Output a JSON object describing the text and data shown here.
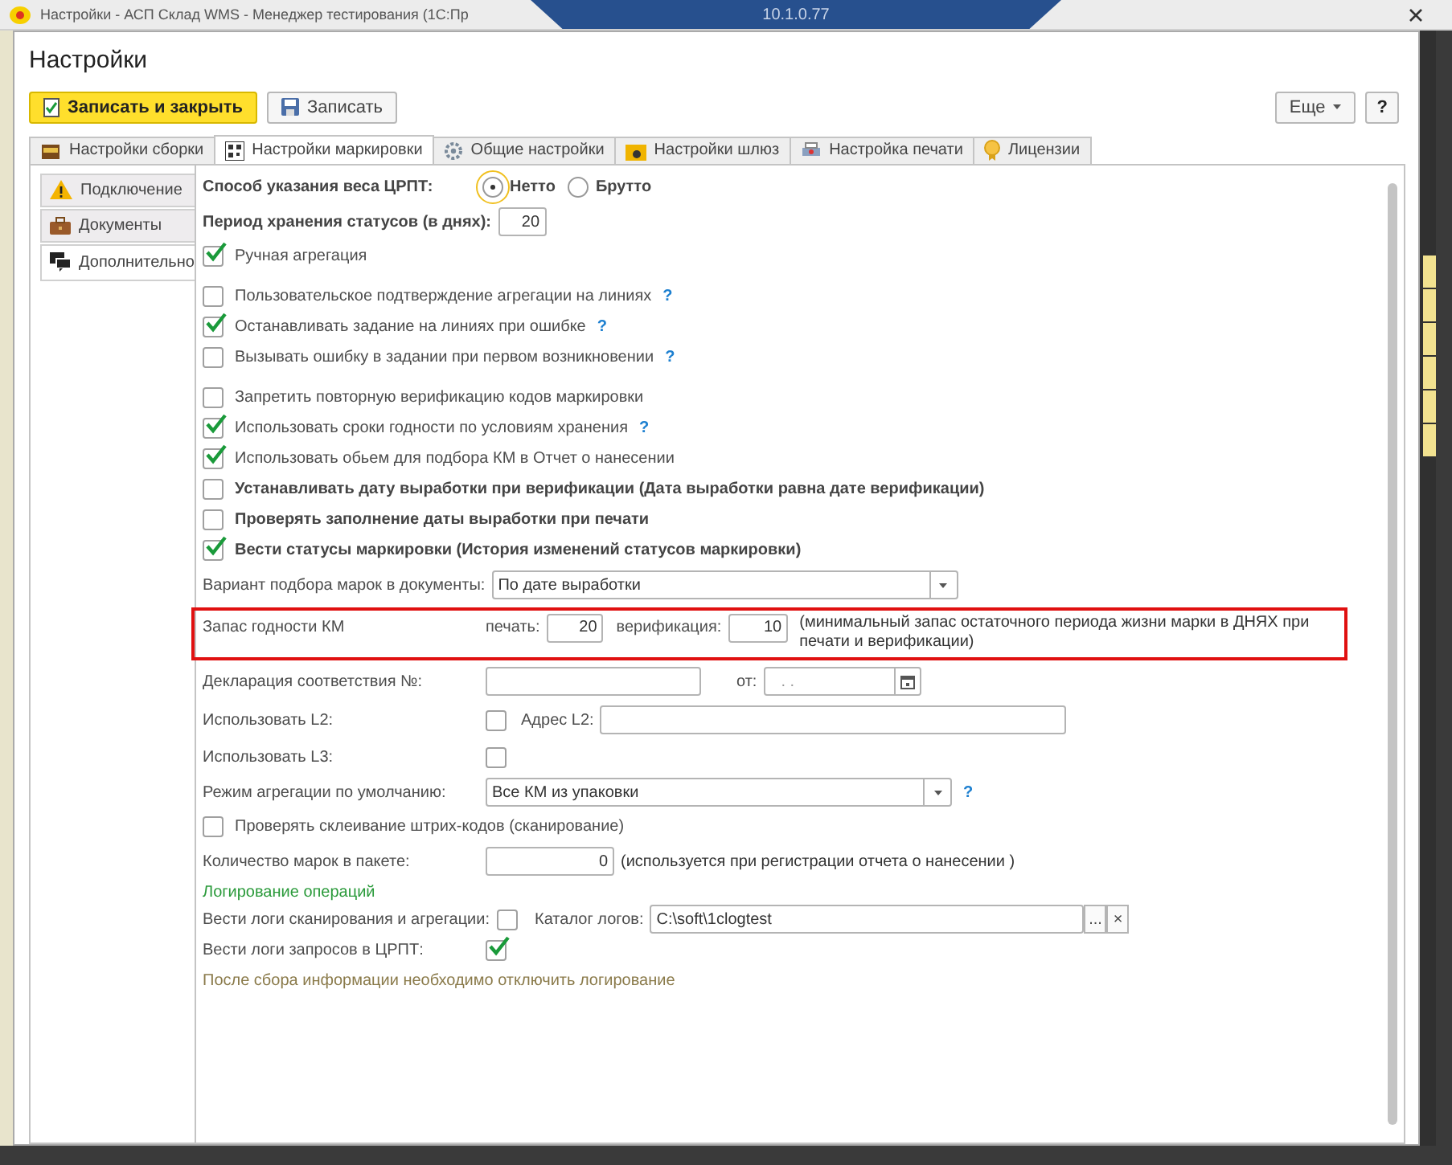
{
  "window": {
    "title": "Настройки - АСП Склад WMS - Менеджер тестирования (1С:Пр",
    "remote_bar": "10.1.0.77"
  },
  "form_title": "Настройки",
  "toolbar": {
    "buttons": [
      {
        "label": "Записать и закрыть",
        "kind": "primary"
      },
      {
        "label": "Записать",
        "kind": "save"
      }
    ],
    "more": "Еще",
    "help": "?"
  },
  "tabs": [
    {
      "label": "Настройки сборки",
      "selected": false
    },
    {
      "label": "Настройки маркировки",
      "selected": true
    },
    {
      "label": "Общие настройки",
      "selected": false
    },
    {
      "label": "Настройки шлюз",
      "selected": false
    },
    {
      "label": "Настройка печати",
      "selected": false
    },
    {
      "label": "Лицензии",
      "selected": false
    }
  ],
  "side_tabs": [
    {
      "label": "Подключение",
      "selected": false
    },
    {
      "label": "Документы",
      "selected": false
    },
    {
      "label": "Дополнительно",
      "selected": true
    }
  ],
  "weight_method": {
    "label": "Способ указания веса ЦРПТ:",
    "options": [
      {
        "label": "Нетто",
        "selected": true
      },
      {
        "label": "Брутто",
        "selected": false
      }
    ]
  },
  "storage_period": {
    "label": "Период хранения статусов (в днях):",
    "value": "20"
  },
  "checkbox_groups": [
    [
      {
        "label": "Ручная агрегация",
        "checked": true,
        "bold": false
      }
    ],
    [
      {
        "label": "Пользовательское подтверждение агрегации на линиях",
        "checked": false,
        "bold": false,
        "help": "?"
      },
      {
        "label": "Останавливать задание на линиях при ошибке",
        "checked": true,
        "bold": false,
        "help": "?"
      },
      {
        "label": "Вызывать ошибку в задании при первом возникновении",
        "checked": false,
        "bold": false,
        "help": "?"
      }
    ],
    [
      {
        "label": "Запретить повторную верификацию кодов маркировки",
        "checked": false,
        "bold": false
      },
      {
        "label": "Использовать сроки годности по условиям хранения",
        "checked": true,
        "bold": false,
        "help": "?"
      },
      {
        "label": "Использовать обьем для подбора КМ в Отчет о нанесении",
        "checked": true,
        "bold": false
      },
      {
        "label": "Устанавливать дату выработки при верификации (Дата выработки равна дате верификации)",
        "checked": false,
        "bold": true
      },
      {
        "label": "Проверять заполнение даты выработки при печати",
        "checked": false,
        "bold": true
      },
      {
        "label": "Вести статусы маркировки (История изменений статусов маркировки)",
        "checked": true,
        "bold": true
      }
    ]
  ],
  "pick_variant": {
    "label": "Вариант подбора марок в документы:",
    "value": "По дате выработки"
  },
  "shelf_life": {
    "label": "Запас годности КМ",
    "print_label": "печать:",
    "print_value": "20",
    "verify_label": "верификация:",
    "verify_value": "10",
    "note": "(минимальный запас остаточного периода жизни марки в ДНЯХ при печати и верификации)"
  },
  "declaration": {
    "label": "Декларация соответствия №:",
    "date_label": "от:",
    "date_value": ". ."
  },
  "use_l2": {
    "label": "Использовать L2:",
    "checked": false,
    "address_label": "Адрес L2:"
  },
  "use_l3": {
    "label": "Использовать L3:",
    "checked": false
  },
  "agg_mode": {
    "label": "Режим агрегации по умолчанию:",
    "value": "Все КМ из упаковки",
    "help": "?"
  },
  "check_glue": {
    "label": "Проверять склеивание штрих-кодов (сканирование)",
    "checked": false
  },
  "pack_count": {
    "label": "Количество марок в пакете:",
    "value": "0",
    "note": "(используется при регистрации  отчета о нанесении )"
  },
  "logging": {
    "header": "Логирование операций",
    "scan_logs": {
      "label": "Вести логи сканирования и агрегации:",
      "checked": false,
      "dir_label": "Каталог логов:",
      "dir_value": "C:\\soft\\1clogtest",
      "choose": "...",
      "clear": "×"
    },
    "crpt_logs": {
      "label": "Вести логи запросов в ЦРПТ:",
      "checked": true
    },
    "note": "После сбора информации необходимо отключить логирование"
  }
}
